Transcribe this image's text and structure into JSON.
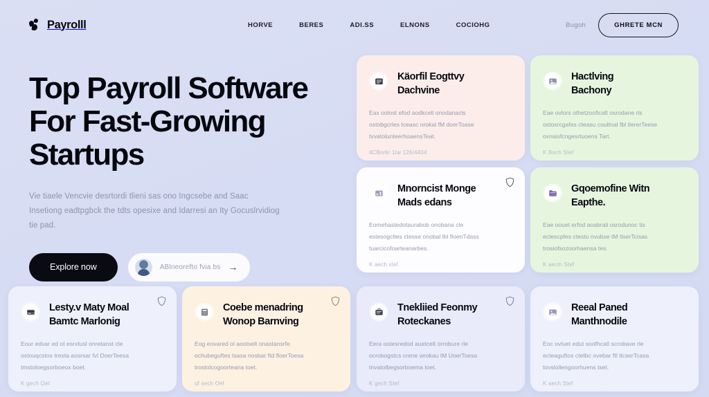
{
  "brand": {
    "name": "Payrolll",
    "mark_icon": "payroll-leaf-mark-icon"
  },
  "nav": {
    "links": [
      {
        "label": "HORVE"
      },
      {
        "label": "BERES"
      },
      {
        "label": "ADI.SS"
      },
      {
        "label": "ELNONS"
      },
      {
        "label": "COCIOHG"
      }
    ],
    "login_label": "Bugoh",
    "cta_label": "GHRETE MCN"
  },
  "hero": {
    "title_line_1": "Top Payroll Software",
    "title_line_2": "For Fast-Growing",
    "title_line_3": "Startups",
    "subtitle_line_1": "Vie tiaele Vencvie desrtordi tlieni sas ono Ingcsebe and Saac Insetiong",
    "subtitle_line_2": "eadtpgbck the tdts opesixe and Idarresi an Ity Gocuslrvidiog tie pad.",
    "primary_button": "Explore now",
    "ghost_button_label": "ABlneorefto fvia bs",
    "ghost_avatar_icon": "user-avatar-icon",
    "ghost_arrow_icon": "arrow-right-icon"
  },
  "cards": [
    {
      "icon": "document-card-icon",
      "title_line_1": "Käorfil Eogttvy",
      "title_line_2": "Dachvine",
      "body_line_1": "Eax oolost efod aodkcell onodanacls",
      "body_line_2": "ostobgcrles tceasc nrokal fM doerToase",
      "body_line_3": "tvvatolunteerhoaensTeat.",
      "footer": "4CBorkr 1tw  126/4404",
      "accent": "#fcedeb",
      "badge": null
    },
    {
      "icon": "image-card-icon",
      "title_line_1": "Hactlving",
      "title_line_2": "Bachony",
      "body_line_1": "Eae ovlors othetzooficalt osrodane rls",
      "body_line_2": "ostosrcgafes cteasu coultnal fbl tlererTeese",
      "body_line_3": "ovnsiofcngesrtuoens Tart.",
      "footer": "K Boch  Stef",
      "accent": "#e6f6de",
      "badge": null
    },
    {
      "icon": "chart-card-icon",
      "title_line_1": "Mnorncist Monge",
      "title_line_2": "Mads edans",
      "body_line_1": "Eomehastedotaurabob onobana cle",
      "body_line_2": "estesogctles ctesse onobal lbl floenTdass",
      "body_line_3": "tuarcicofoarteanarbes.",
      "footer": "K aech  stef",
      "accent": "#fdfdff",
      "badge": "shield-icon"
    },
    {
      "icon": "folder-card-icon",
      "title_line_1": "Gqoemofine Witn",
      "title_line_2": "Eapthe.",
      "body_line_1": "Eae oouet erfod aoabrali osrodunoc tis",
      "body_line_2": "ectescpfes ctestu nvubse tM tlserTcisas",
      "body_line_3": "trosiofsozoorhaensa tes.",
      "footer": "K aecln  Stef",
      "accent": "#e6f6de",
      "badge": null
    },
    {
      "icon": "card-payment-icon",
      "title_line_1": "Lesty.v Maty Moal",
      "title_line_2": "Bamtc Marlonig",
      "body_line_1": "Eour edvar ed ot esrxtusl onretanst cle",
      "body_line_2": "ostouqcstos tresta aosrsar fvl DoerTeesa",
      "body_line_3": "tmstoloegsorboeox boet.",
      "footer": "K gech  Oet",
      "accent": "#eef1fc",
      "badge": "shield-icon"
    },
    {
      "icon": "calculator-card-icon",
      "title_line_1": "Coebe menadring",
      "title_line_2": "Wonop Barnving",
      "body_line_1": "Eog eovared ol aootselt onastansrfe",
      "body_line_2": "ochubeguftes tsasa nosbar ftd floerToesa",
      "body_line_3": "trostolcogoorteana toet.",
      "footer": "uf sech  Oef",
      "accent": "#fdf1e2",
      "badge": "shield-icon"
    },
    {
      "icon": "briefcase-card-icon",
      "title_line_1": "Tnekliied Feonmy",
      "title_line_2": "Roteckanes",
      "body_line_1": "Eera ootesredod auetcelt orrobure rle",
      "body_line_2": "ocrobogstcs crene wrokau tM UoerToesa",
      "body_line_3": "tnvatolbegsorboema toet.",
      "footer": "K gech  Stef",
      "accent": "#e9ebfa",
      "badge": "shield-icon"
    },
    {
      "icon": "photo-card-icon",
      "title_line_1": "Reeal Paned",
      "title_line_2": "Manthnodile",
      "body_line_1": "Eoc ovluet edut soofhcatl scrobave rle",
      "body_line_2": "ecteaguftos ctetbc ovebar ftl tlcserTcasa",
      "body_line_3": "tovslollengoorhuens tset.",
      "footer": "K aech  Stef",
      "accent": "#eef1fc",
      "badge": null
    }
  ]
}
